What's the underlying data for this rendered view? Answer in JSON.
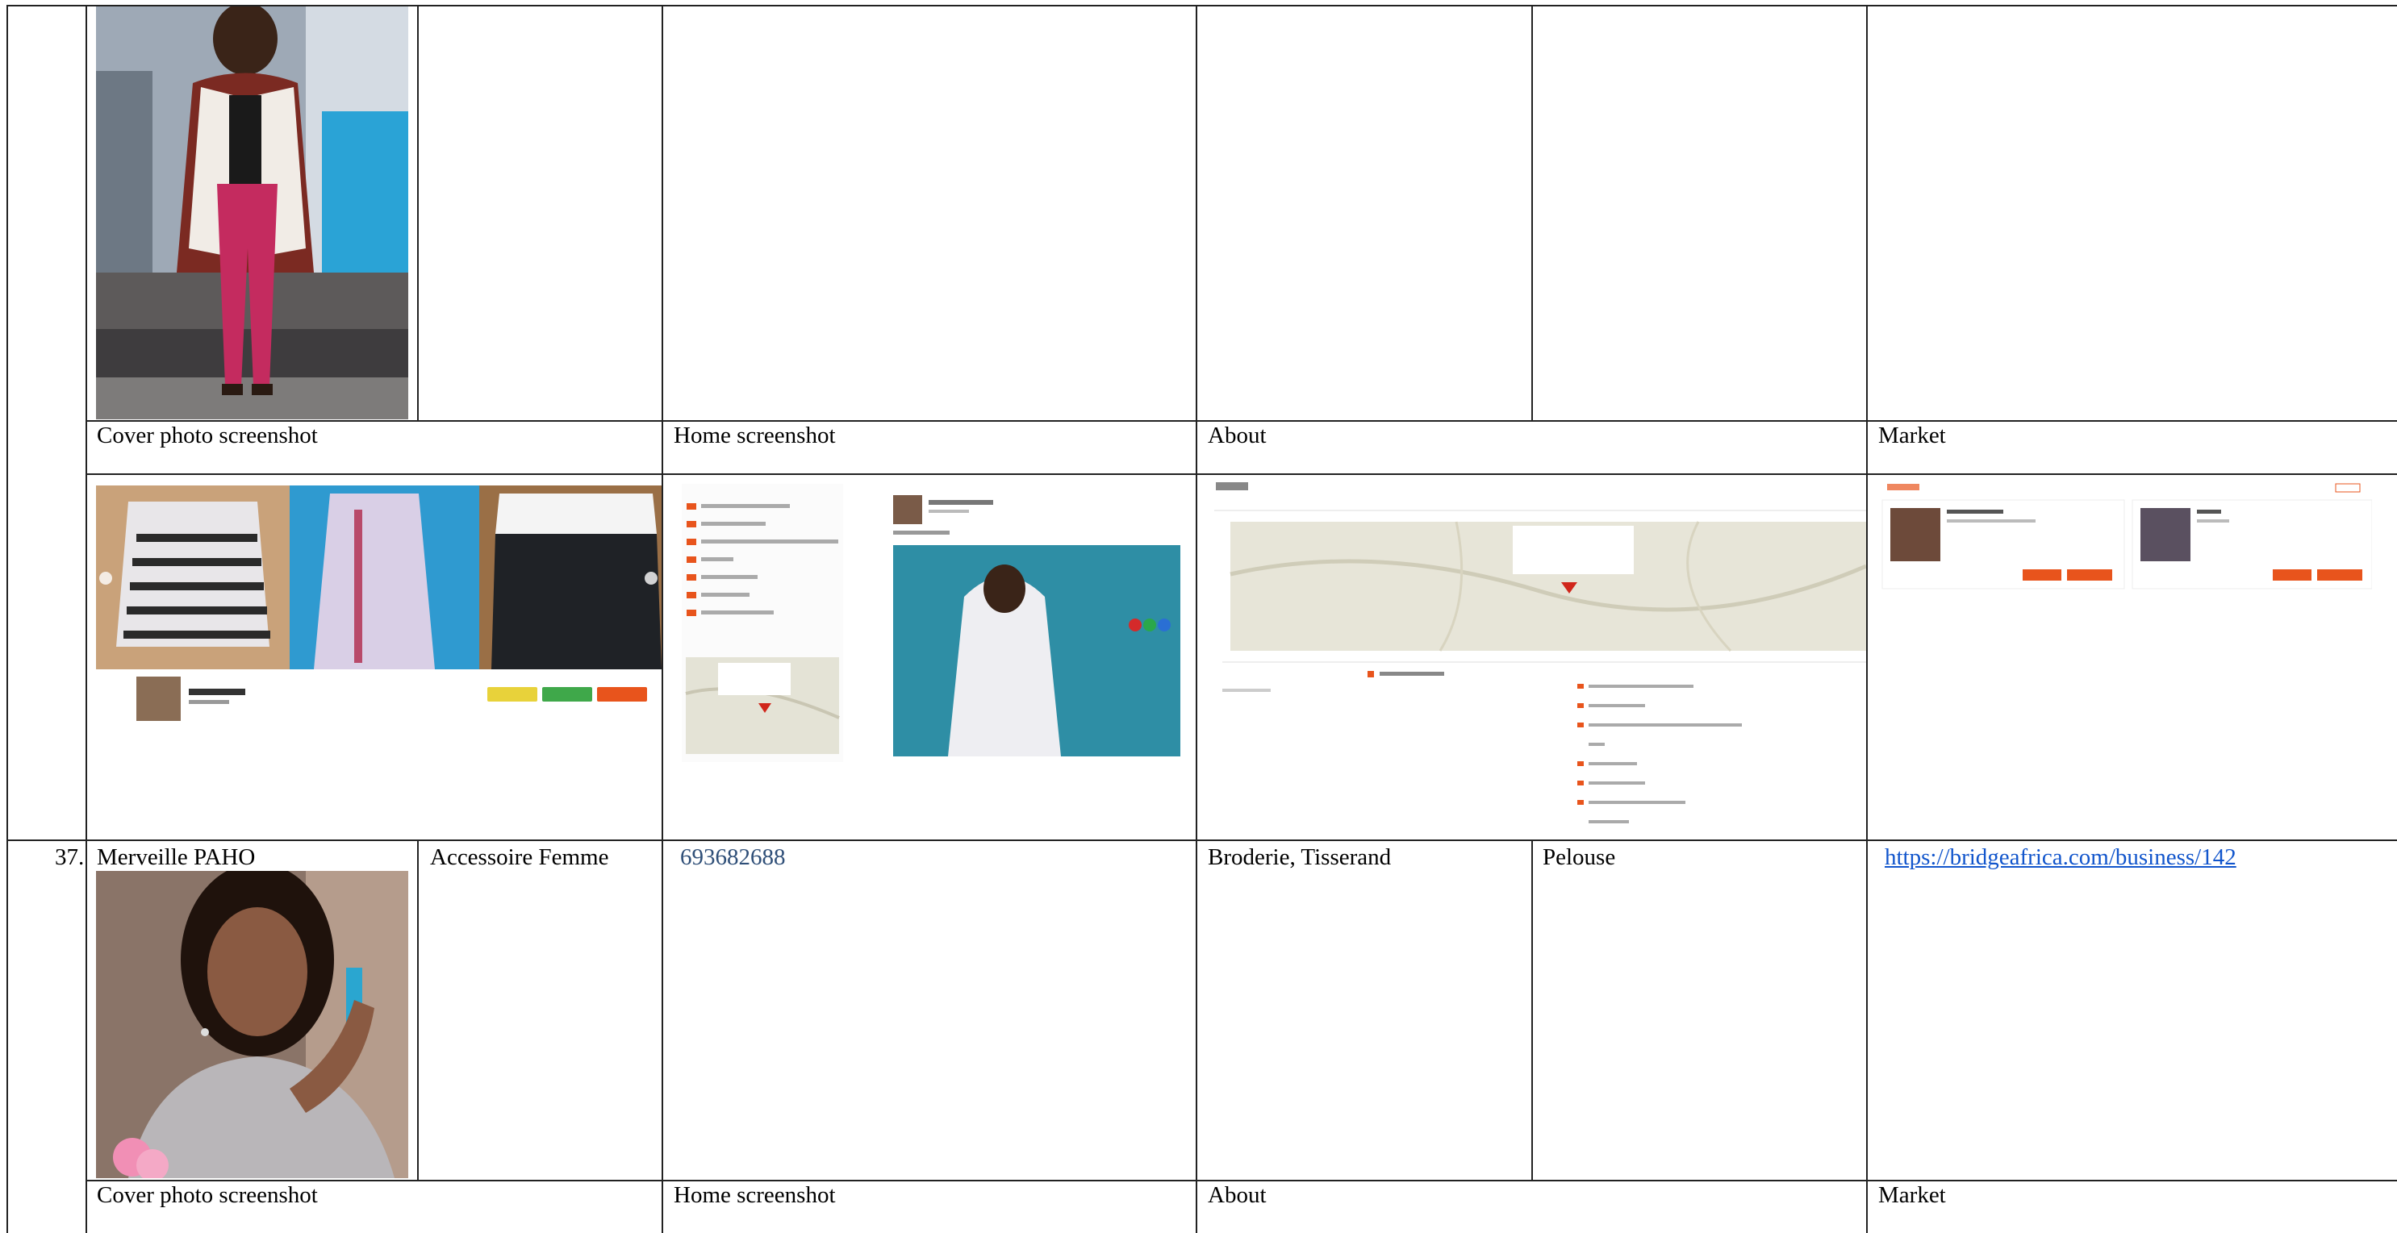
{
  "row_prev": {
    "captions": {
      "cover": "Cover photo screenshot",
      "home": "Home screenshot",
      "about": "About",
      "market": "Market"
    }
  },
  "row_37": {
    "number": "37.",
    "name": "Merveille PAHO",
    "category": "Accessoire Femme",
    "phone": "693682688",
    "skills": "Broderie, Tisserand",
    "location": "Pelouse",
    "link": "https://bridgeafrica.com/business/142",
    "captions": {
      "cover": "Cover photo screenshot",
      "home": "Home screenshot",
      "about": "About",
      "market": "Market"
    }
  },
  "colors": {
    "grid_line": "#222222",
    "phone_text": "#2f4f78",
    "link_text": "#1155cc",
    "brand_orange": "#e8541c"
  }
}
